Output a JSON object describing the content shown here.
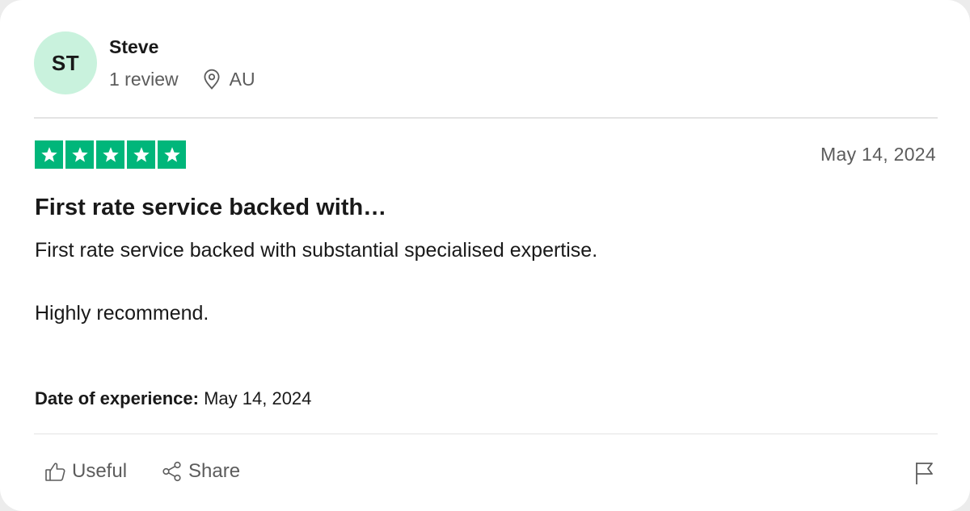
{
  "reviewer": {
    "initials": "ST",
    "name": "Steve",
    "review_count": "1 review",
    "location": "AU",
    "avatar_color": "#c9f2dd"
  },
  "review": {
    "rating": 5,
    "rating_max": 5,
    "star_color": "#00b67a",
    "date": "May 14, 2024",
    "title": "First rate service backed with…",
    "body": [
      "First rate service backed with substantial specialised expertise.",
      "Highly recommend."
    ],
    "experience_label": "Date of experience:",
    "experience_date": "May 14, 2024"
  },
  "actions": {
    "useful_label": "Useful",
    "share_label": "Share",
    "icons": {
      "useful": "thumbs-up-icon",
      "share": "share-icon",
      "flag": "flag-icon",
      "location": "location-pin-icon",
      "star": "star-icon"
    }
  }
}
